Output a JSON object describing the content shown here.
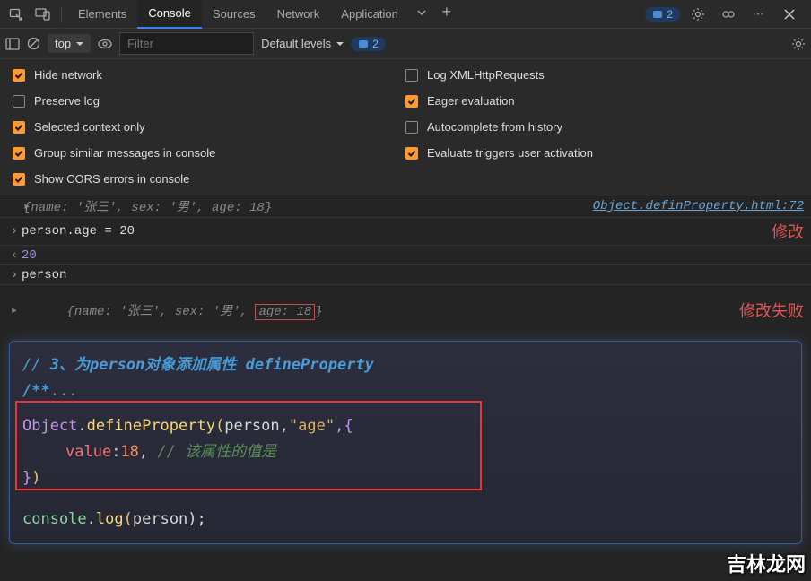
{
  "tabs": [
    "Elements",
    "Console",
    "Sources",
    "Network",
    "Application"
  ],
  "active_tab": "Console",
  "badge_top": "2",
  "toolbar": {
    "context": "top",
    "filter_placeholder": "Filter",
    "levels": "Default levels",
    "issues": "2"
  },
  "settings": {
    "left": [
      {
        "label": "Hide network",
        "checked": true
      },
      {
        "label": "Preserve log",
        "checked": false
      },
      {
        "label": "Selected context only",
        "checked": true
      },
      {
        "label": "Group similar messages in console",
        "checked": true
      },
      {
        "label": "Show CORS errors in console",
        "checked": true
      }
    ],
    "right": [
      {
        "label": "Log XMLHttpRequests",
        "checked": false
      },
      {
        "label": "Eager evaluation",
        "checked": true
      },
      {
        "label": "Autocomplete from history",
        "checked": false
      },
      {
        "label": "Evaluate triggers user activation",
        "checked": true
      }
    ]
  },
  "console": {
    "line1_obj": "{name: '张三', sex: '男', age: 18}",
    "line1_src": "Object.definProperty.html:72",
    "input1": "person.age = 20",
    "annot1": "修改",
    "output1": "20",
    "input2": "person",
    "output2_pre": "{name: '张三', sex: '男', ",
    "output2_box": "age: 18",
    "output2_post": "}",
    "annot2": "修改失败"
  },
  "code": {
    "c1": "// 3、为person对象添加属性 defineProperty",
    "c2": "/**",
    "c2b": "...",
    "l1_a": "Object",
    "l1_b": ".",
    "l1_c": "defineProperty",
    "l1_d": "(",
    "l1_e": "person",
    "l1_f": ",",
    "l1_g": "\"age\"",
    "l1_h": ",{",
    "l2_a": "value",
    "l2_b": ":",
    "l2_c": "18",
    "l2_d": ", ",
    "l2_e": "// 该属性的值是",
    "l3": "})",
    "l5_a": "console",
    "l5_b": ".",
    "l5_c": "log",
    "l5_d": "(",
    "l5_e": "person",
    "l5_f": ");"
  },
  "watermark": "吉林龙网"
}
